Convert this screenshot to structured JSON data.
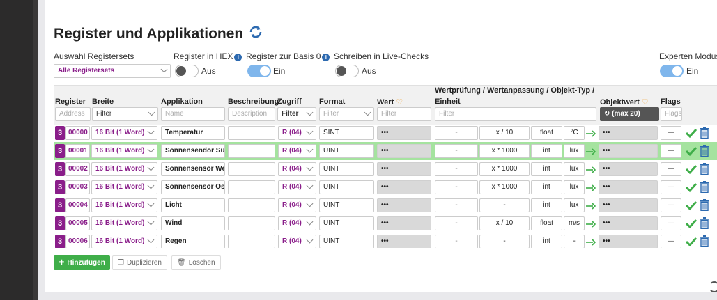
{
  "page": {
    "title": "Register und Applikationen",
    "refresh_icon": "refresh-icon"
  },
  "options": {
    "registersets_label": "Auswahl Registersets",
    "registersets_value": "Alle Registersets",
    "hex_label": "Register in HEX",
    "hex_state": "Aus",
    "base0_label": "Register zur Basis 0",
    "base0_state": "Ein",
    "livechecks_label": "Schreiben in Live-Checks",
    "livechecks_state": "Aus",
    "expert_label": "Experten Modus",
    "expert_state": "Ein"
  },
  "columns": {
    "register": "Register",
    "breite": "Breite",
    "applikation": "Applikation",
    "beschreibung": "Beschreibung",
    "zugriff": "Zugriff",
    "format": "Format",
    "wert": "Wert",
    "wertpruefung": "Wertprüfung / Wertanpassung / Objekt-Typ /",
    "einheit": "Einheit",
    "objektwert": "Objektwert",
    "flags": "Flags"
  },
  "filters": {
    "address": "Address",
    "breite": "Filter",
    "name": "Name",
    "description": "Description",
    "zugriff": "Filter",
    "format": "Filter",
    "wert": "Filter",
    "wertpruefung": "Filter",
    "objektwert": "(max 20)",
    "flags": "Flags"
  },
  "rows": [
    {
      "set": "3",
      "address": "00000",
      "width": "16 Bit (1 Word)",
      "app": "Temperatur",
      "desc": "",
      "access": "R (04)",
      "format": "SINT",
      "value": "•••",
      "check": "-",
      "adjust": "x / 10",
      "type": "float",
      "unit": "°C",
      "obj": "•••",
      "flags": "—"
    },
    {
      "set": "3",
      "address": "00001",
      "width": "16 Bit (1 Word)",
      "app": "Sonnensendor Süd",
      "desc": "",
      "access": "R (04)",
      "format": "UINT",
      "value": "•••",
      "check": "-",
      "adjust": "x * 1000",
      "type": "int",
      "unit": "lux",
      "obj": "•••",
      "flags": "—"
    },
    {
      "set": "3",
      "address": "00002",
      "width": "16 Bit (1 Word)",
      "app": "Sonnensensor West",
      "desc": "",
      "access": "R (04)",
      "format": "UINT",
      "value": "•••",
      "check": "-",
      "adjust": "x * 1000",
      "type": "int",
      "unit": "lux",
      "obj": "•••",
      "flags": "—"
    },
    {
      "set": "3",
      "address": "00003",
      "width": "16 Bit (1 Word)",
      "app": "Sonnensensor Ost",
      "desc": "",
      "access": "R (04)",
      "format": "UINT",
      "value": "•••",
      "check": "-",
      "adjust": "x * 1000",
      "type": "int",
      "unit": "lux",
      "obj": "•••",
      "flags": "—"
    },
    {
      "set": "3",
      "address": "00004",
      "width": "16 Bit (1 Word)",
      "app": "Licht",
      "desc": "",
      "access": "R (04)",
      "format": "UINT",
      "value": "•••",
      "check": "-",
      "adjust": "-",
      "type": "int",
      "unit": "lux",
      "obj": "•••",
      "flags": "—"
    },
    {
      "set": "3",
      "address": "00005",
      "width": "16 Bit (1 Word)",
      "app": "Wind",
      "desc": "",
      "access": "R (04)",
      "format": "UINT",
      "value": "•••",
      "check": "-",
      "adjust": "x / 10",
      "type": "float",
      "unit": "m/s",
      "obj": "•••",
      "flags": "—"
    },
    {
      "set": "3",
      "address": "00006",
      "width": "16 Bit (1 Word)",
      "app": "Regen",
      "desc": "",
      "access": "R (04)",
      "format": "UINT",
      "value": "•••",
      "check": "-",
      "adjust": "-",
      "type": "int",
      "unit": "-",
      "obj": "•••",
      "flags": "—"
    }
  ],
  "actions": {
    "add": "Hinzufügen",
    "duplicate": "Duplizieren",
    "delete": "Löschen"
  },
  "colors": {
    "accent": "#8a1e8a",
    "highlight": "#a5e39f",
    "toggle_on": "#7fb6ec",
    "add_button": "#3fae49",
    "check": "#3fae49"
  }
}
